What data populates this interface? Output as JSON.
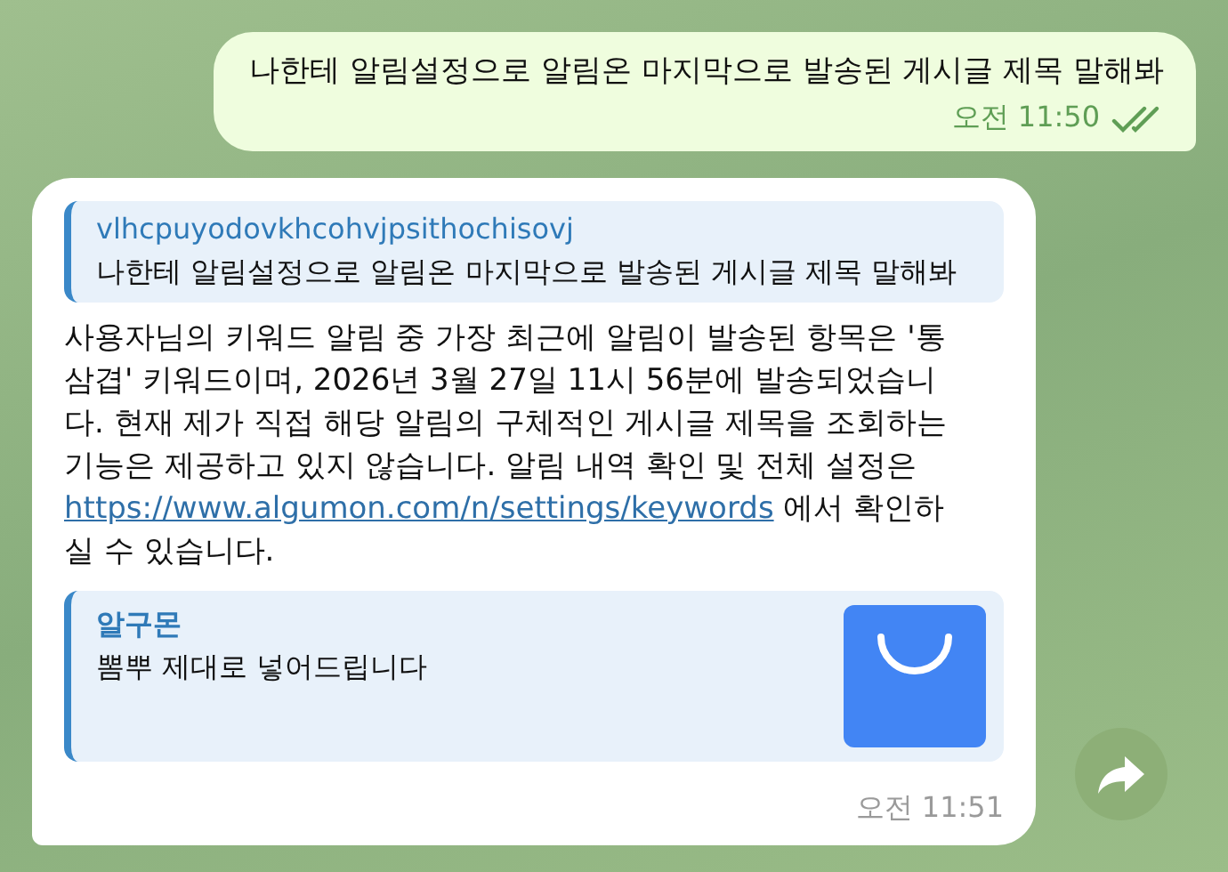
{
  "outgoing": {
    "text": "나한테 알림설정으로 알림온 마지막으로 발송된 게시글 제목 말해봐",
    "time": "오전 11:50",
    "read": true
  },
  "incoming": {
    "reply": {
      "author": "vlhcpuyodovkhcohvjpsithochisovj",
      "text": "나한테 알림설정으로 알림온 마지막으로 발송된 게시글 제목 말해봐"
    },
    "body_before": "사용자님의 키워드 알림 중 가장 최근에 알림이 발송된 항목은 '통삼겹' 키워드이며, 2026년 3월 27일 11시 56분에 발송되었습니다. 현재 제가 직접 해당 알림의 구체적인 게시글 제목을 조회하는 기능은 제공하고 있지 않습니다. 알림 내역 확인 및 전체 설정은 ",
    "link": "https://www.algumon.com/n/settings/keywords",
    "body_after": " 에서 확인하실 수 있습니다.",
    "link_preview": {
      "site": "알구몬",
      "description": "뽐뿌 제대로 넣어드립니다"
    },
    "time": "오전 11:51"
  }
}
